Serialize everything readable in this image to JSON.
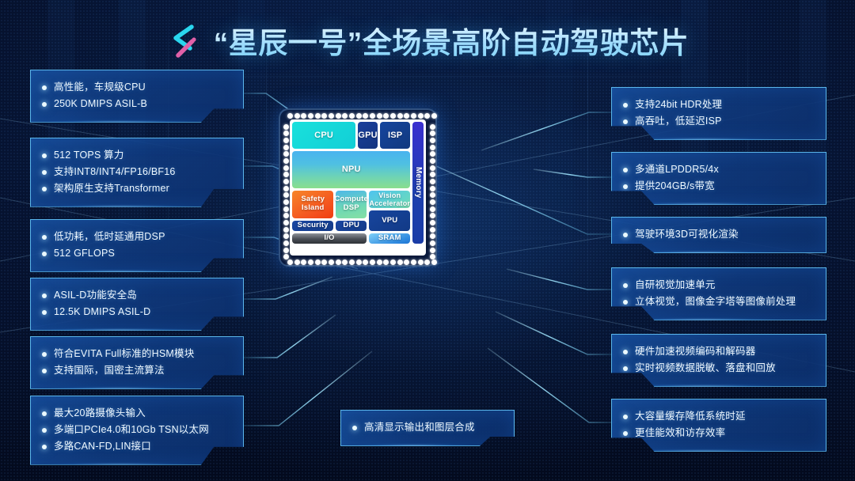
{
  "header": {
    "logo_icon": "chevron-spark-logo",
    "title": "“星辰一号”全场景高阶自动驾驶芯片"
  },
  "chip": {
    "blocks": [
      {
        "id": "cpu",
        "label": "CPU",
        "color": "#19e0dc"
      },
      {
        "id": "gpu",
        "label": "GPU",
        "color": "#1b3f9c"
      },
      {
        "id": "isp",
        "label": "ISP",
        "color": "#14459e"
      },
      {
        "id": "memory",
        "label": "Memory",
        "color": "#2a37c4"
      },
      {
        "id": "npu",
        "label": "NPU",
        "color": "#4fc0e2"
      },
      {
        "id": "safety",
        "label": "Safety Island",
        "color": "#f4511e"
      },
      {
        "id": "cdsp",
        "label": "Compute DSP",
        "color": "#6ed8b4"
      },
      {
        "id": "vacc",
        "label": "Vision Accelerator",
        "color": "#5ed2da"
      },
      {
        "id": "vpu",
        "label": "VPU",
        "color": "#17459e"
      },
      {
        "id": "security",
        "label": "Security",
        "color": "#1a47a2"
      },
      {
        "id": "dpu",
        "label": "DPU",
        "color": "#1a47a2"
      },
      {
        "id": "io",
        "label": "I/O",
        "color": "#4a4e55"
      },
      {
        "id": "sram",
        "label": "SRAM",
        "color": "#2f8ae0"
      }
    ]
  },
  "callouts": {
    "left": [
      {
        "id": "cpu",
        "lines": [
          "高性能，车规级CPU",
          "250K DMIPS ASIL-B"
        ]
      },
      {
        "id": "npu",
        "lines": [
          "512 TOPS 算力",
          "支持INT8/INT4/FP16/BF16",
          "架构原生支持Transformer"
        ]
      },
      {
        "id": "dsp",
        "lines": [
          "低功耗，低时延通用DSP",
          "512 GFLOPS"
        ]
      },
      {
        "id": "safety",
        "lines": [
          "ASIL-D功能安全岛",
          "12.5K DMIPS ASIL-D"
        ]
      },
      {
        "id": "security",
        "lines": [
          "符合EVITA Full标准的HSM模块",
          "支持国际，国密主流算法"
        ]
      },
      {
        "id": "io",
        "lines": [
          "最大20路摄像头输入",
          "多端口PCIe4.0和10Gb TSN以太网",
          "多路CAN-FD,LIN接口"
        ]
      }
    ],
    "right": [
      {
        "id": "isp",
        "lines": [
          "支持24bit HDR处理",
          "高吞吐，低延迟ISP"
        ]
      },
      {
        "id": "memory",
        "lines": [
          "多通道LPDDR5/4x",
          "提供204GB/s带宽"
        ]
      },
      {
        "id": "gpu",
        "lines": [
          "驾驶环境3D可视化渲染"
        ]
      },
      {
        "id": "vacc",
        "lines": [
          "自研视觉加速单元",
          "立体视觉，图像金字塔等图像前处理"
        ]
      },
      {
        "id": "vpu",
        "lines": [
          "硬件加速视频编码和解码器",
          "实时视频数据脱敏、落盘和回放"
        ]
      },
      {
        "id": "sram",
        "lines": [
          "大容量缓存降低系统时延",
          "更佳能效和访存效率"
        ]
      }
    ],
    "center": [
      {
        "id": "dpu",
        "lines": [
          "高清显示输出和图层合成"
        ]
      }
    ]
  },
  "colors": {
    "accent_cyan": "#69cdff",
    "background_navy": "#061434",
    "box_fill": "#0f397d",
    "title_glow": "#7fd4f7",
    "logo_cyan": "#2ad6ee",
    "logo_pink": "#e060a8"
  }
}
